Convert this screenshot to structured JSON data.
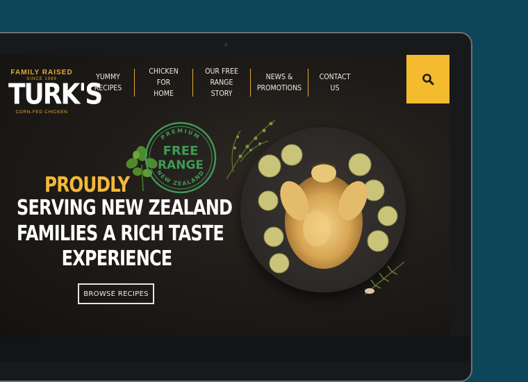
{
  "brand": {
    "tagline_top": "FAMILY RAISED",
    "since": "SINCE 1999",
    "name": "TURK'S",
    "tagline_bottom": "CORN-FED CHICKEN"
  },
  "nav": {
    "items": [
      {
        "label_line1": "YUMMY",
        "label_line2": "RECIPES"
      },
      {
        "label_line1": "CHICKEN FOR",
        "label_line2": "HOME"
      },
      {
        "label_line1": "OUR FREE",
        "label_line2": "RANGE STORY"
      },
      {
        "label_line1": "NEWS &",
        "label_line2": "PROMOTIONS"
      },
      {
        "label_line1": "CONTACT US",
        "label_line2": ""
      }
    ],
    "search_icon": "search-icon"
  },
  "stamp": {
    "top_text": "PREMIUM",
    "line1": "FREE",
    "line2": "RANGE",
    "bottom_text": "NEW ZEALAND"
  },
  "hero": {
    "accent": "PROUDLY",
    "line1": "SERVING NEW ZEALAND",
    "line2": "FAMILIES A RICH TASTE",
    "line3": "EXPERIENCE",
    "cta_label": "BROWSE RECIPES"
  },
  "colors": {
    "background": "#0f4558",
    "accent": "#f4bb2e",
    "stamp_green": "#3f9a55"
  }
}
